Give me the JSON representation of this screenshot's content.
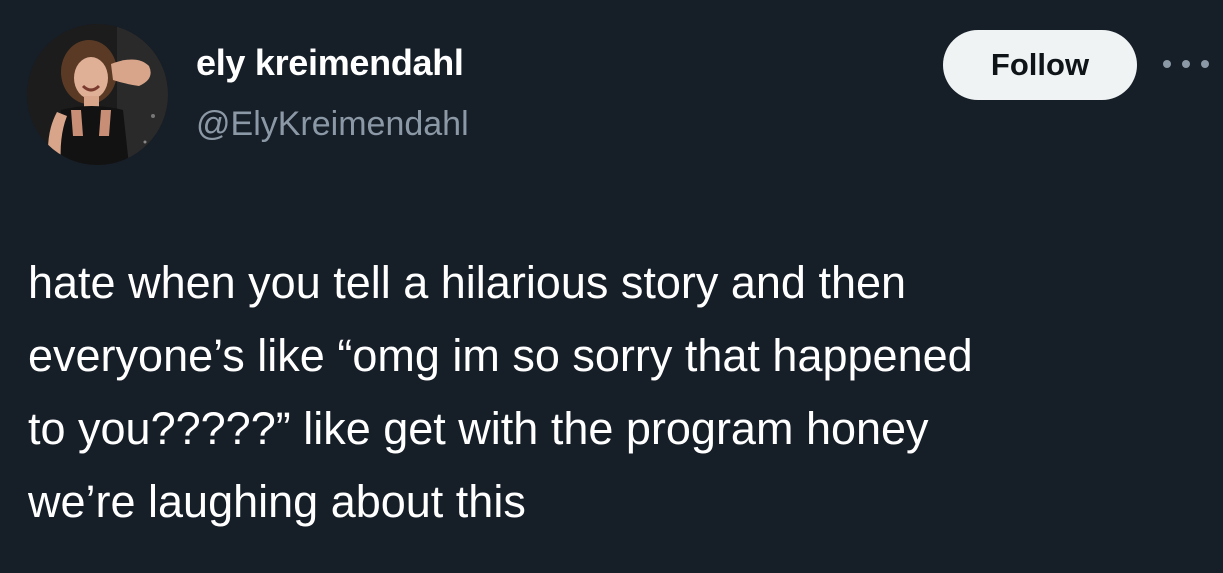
{
  "author": {
    "display_name": "ely kreimendahl",
    "handle": "@ElyKreimendahl",
    "avatar_icon": "profile-photo"
  },
  "actions": {
    "follow_label": "Follow",
    "more_icon": "more-horizontal-icon"
  },
  "tweet": {
    "lines": [
      "hate when you tell a hilarious story and then",
      "everyone’s like “omg im so sorry that happened",
      "to you?????” like get with the program honey",
      "we’re laughing about this"
    ]
  },
  "colors": {
    "background": "#161e28",
    "text_primary": "#ffffff",
    "text_secondary": "#8b98a5",
    "follow_button_bg": "#eff3f4",
    "follow_button_text": "#0f1419"
  }
}
